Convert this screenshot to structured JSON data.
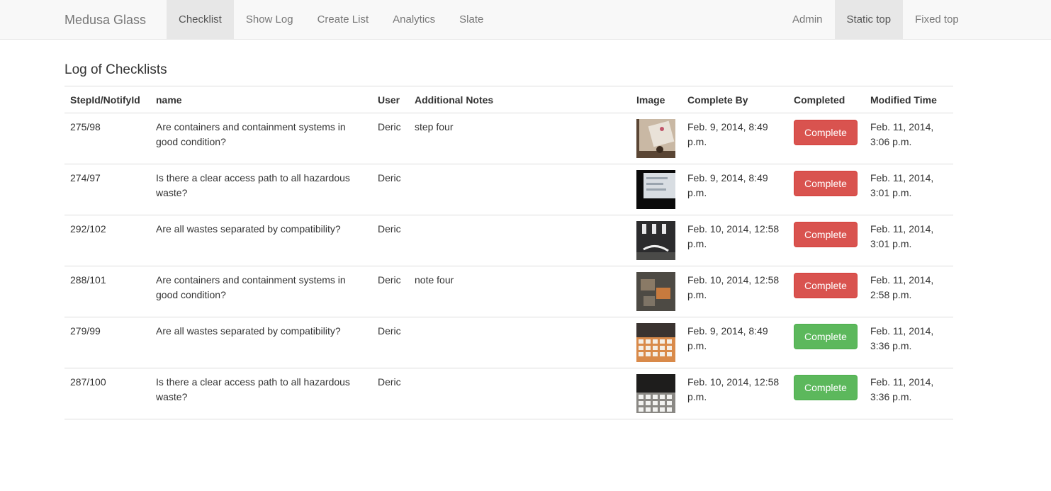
{
  "navbar": {
    "brand": "Medusa Glass",
    "left_items": [
      {
        "label": "Checklist",
        "active": true
      },
      {
        "label": "Show Log",
        "active": false
      },
      {
        "label": "Create List",
        "active": false
      },
      {
        "label": "Analytics",
        "active": false
      },
      {
        "label": "Slate",
        "active": false
      }
    ],
    "right_items": [
      {
        "label": "Admin",
        "active": false
      },
      {
        "label": "Static top",
        "active": true
      },
      {
        "label": "Fixed top",
        "active": false
      }
    ]
  },
  "page": {
    "title": "Log of Checklists"
  },
  "table": {
    "headers": [
      "StepId/NotifyId",
      "name",
      "User",
      "Additional Notes",
      "Image",
      "Complete By",
      "Completed",
      "Modified Time"
    ],
    "rows": [
      {
        "id": "275/98",
        "name": "Are containers and containment systems in good condition?",
        "user": "Deric",
        "notes": "step four",
        "image": "photo-table-note",
        "complete_by": "Feb. 9, 2014, 8:49 p.m.",
        "completed_label": "Complete",
        "completed": false,
        "modified": "Feb. 11, 2014, 3:06 p.m."
      },
      {
        "id": "274/97",
        "name": "Is there a clear access path to all hazardous waste?",
        "user": "Deric",
        "notes": "",
        "image": "photo-monitor",
        "complete_by": "Feb. 9, 2014, 8:49 p.m.",
        "completed_label": "Complete",
        "completed": false,
        "modified": "Feb. 11, 2014, 3:01 p.m."
      },
      {
        "id": "292/102",
        "name": "Are all wastes separated by compatibility?",
        "user": "Deric",
        "notes": "",
        "image": "photo-cable",
        "complete_by": "Feb. 10, 2014, 12:58 p.m.",
        "completed_label": "Complete",
        "completed": false,
        "modified": "Feb. 11, 2014, 3:01 p.m."
      },
      {
        "id": "288/101",
        "name": "Are containers and containment systems in good condition?",
        "user": "Deric",
        "notes": "note four",
        "image": "photo-floor",
        "complete_by": "Feb. 10, 2014, 12:58 p.m.",
        "completed_label": "Complete",
        "completed": false,
        "modified": "Feb. 11, 2014, 2:58 p.m."
      },
      {
        "id": "279/99",
        "name": "Are all wastes separated by compatibility?",
        "user": "Deric",
        "notes": "",
        "image": "photo-keyboard",
        "complete_by": "Feb. 9, 2014, 8:49 p.m.",
        "completed_label": "Complete",
        "completed": true,
        "modified": "Feb. 11, 2014, 3:36 p.m."
      },
      {
        "id": "287/100",
        "name": "Is there a clear access path to all hazardous waste?",
        "user": "Deric",
        "notes": "",
        "image": "photo-keyboard-dark",
        "complete_by": "Feb. 10, 2014, 12:58 p.m.",
        "completed_label": "Complete",
        "completed": true,
        "modified": "Feb. 11, 2014, 3:36 p.m."
      }
    ]
  },
  "colors": {
    "danger": "#d9534f",
    "success": "#5cb85c",
    "navbar_bg": "#f8f8f8",
    "nav_active_bg": "#e7e7e7"
  }
}
